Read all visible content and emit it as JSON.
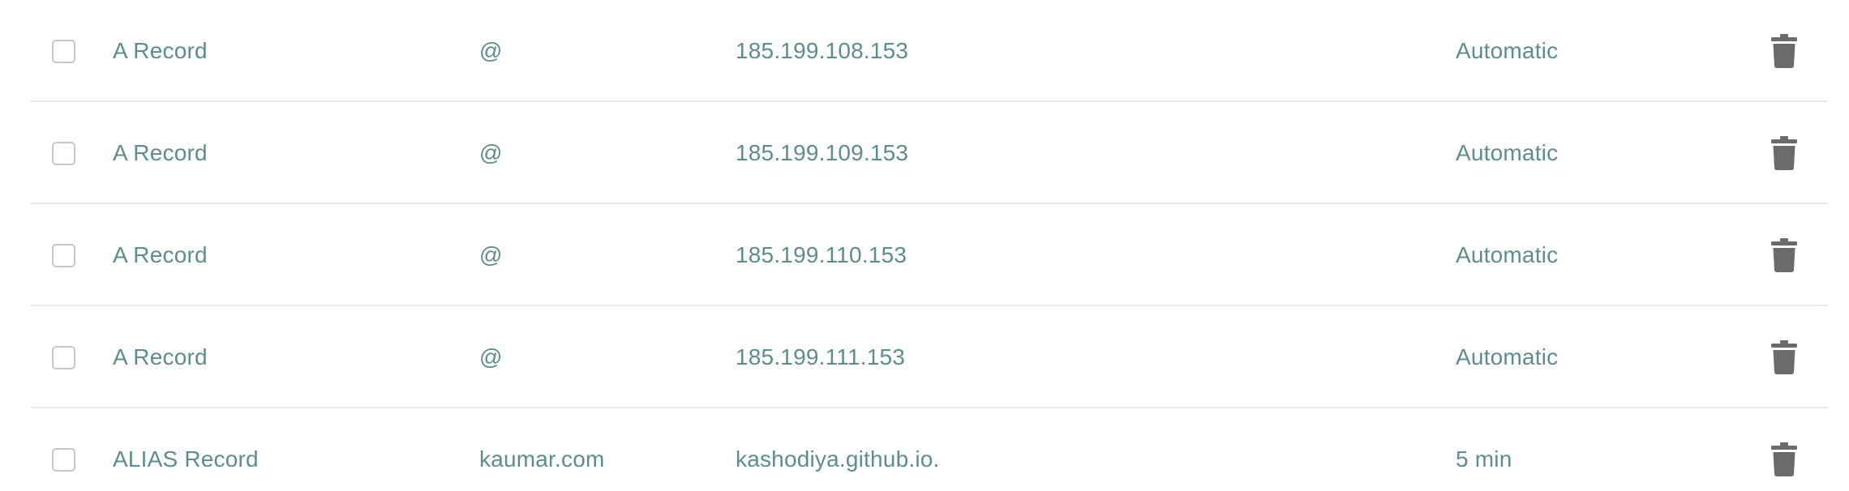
{
  "records": [
    {
      "type": "A Record",
      "host": "@",
      "value": "185.199.108.153",
      "ttl": "Automatic"
    },
    {
      "type": "A Record",
      "host": "@",
      "value": "185.199.109.153",
      "ttl": "Automatic"
    },
    {
      "type": "A Record",
      "host": "@",
      "value": "185.199.110.153",
      "ttl": "Automatic"
    },
    {
      "type": "A Record",
      "host": "@",
      "value": "185.199.111.153",
      "ttl": "Automatic"
    },
    {
      "type": "ALIAS Record",
      "host": "kaumar.com",
      "value": "kashodiya.github.io.",
      "ttl": "5 min"
    }
  ],
  "colors": {
    "text": "#5f8c8c",
    "divider": "#e6e9eb",
    "checkbox_border": "#c3c8cc",
    "trash_icon": "#6b6b6b"
  },
  "icons": {
    "delete": "trash-icon"
  }
}
